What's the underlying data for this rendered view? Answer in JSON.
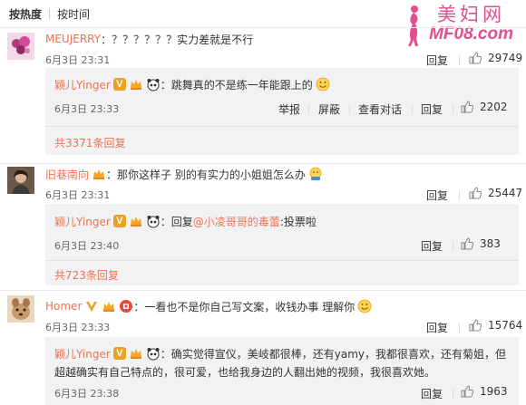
{
  "sort": {
    "hot": "按热度",
    "time": "按时间"
  },
  "watermark": {
    "cn": "美妇网",
    "url": "MF08.com"
  },
  "comments": [
    {
      "user": "MEUJERRY",
      "text": "：？？？？？？实力差就是不行",
      "time": "6月3日 23:31",
      "reply_label": "回复",
      "likes": "29749",
      "reply": {
        "user": "颖儿Yinger",
        "text": "：跳舞真的不是练一年能跟上的",
        "time": "6月3日 23:33",
        "report": "举报",
        "block": "屏蔽",
        "view_dialog": "查看对话",
        "reply_label": "回复",
        "likes": "2202"
      },
      "more": "共3371条回复"
    },
    {
      "user": "旧巷南向",
      "text": "：那你这样子 别的有实力的小姐姐怎么办",
      "time": "6月3日 23:31",
      "reply_label": "回复",
      "likes": "25447",
      "reply": {
        "user": "颖儿Yinger",
        "text_prefix": "：回复",
        "mention": "@小凌哥哥的毒蕾",
        "text_suffix": ":投票啦",
        "time": "6月3日 23:40",
        "reply_label": "回复",
        "likes": "383"
      },
      "more": "共723条回复"
    },
    {
      "user": "Homer",
      "text": "：一看也不是你自己写文案，收钱办事 理解你",
      "time": "6月3日 23:33",
      "reply_label": "回复",
      "likes": "15764",
      "reply": {
        "user": "颖儿Yinger",
        "text_line1": "：确实觉得宣仪，美岐都很棒，还有yamy，我都很喜欢，还有菊姐，但",
        "text_line2": "超越确实有自己特点的，很可爱，也给我身边的人翻出她的视频，我很喜欢她。",
        "time": "6月3日 23:38",
        "reply_label": "回复",
        "likes": "1963"
      }
    }
  ],
  "icons": {
    "like": "thumbs-up-icon",
    "vip": "v-badge-icon",
    "member": "crown-icon",
    "panda": "panda-icon",
    "level": "level-badge-icon",
    "smile": "smile-emoji-icon"
  },
  "colors": {
    "accent": "#eb7350",
    "reply_bg": "#f2f2f5",
    "vip": "#f0a020",
    "watermark": "#e24e8f"
  }
}
